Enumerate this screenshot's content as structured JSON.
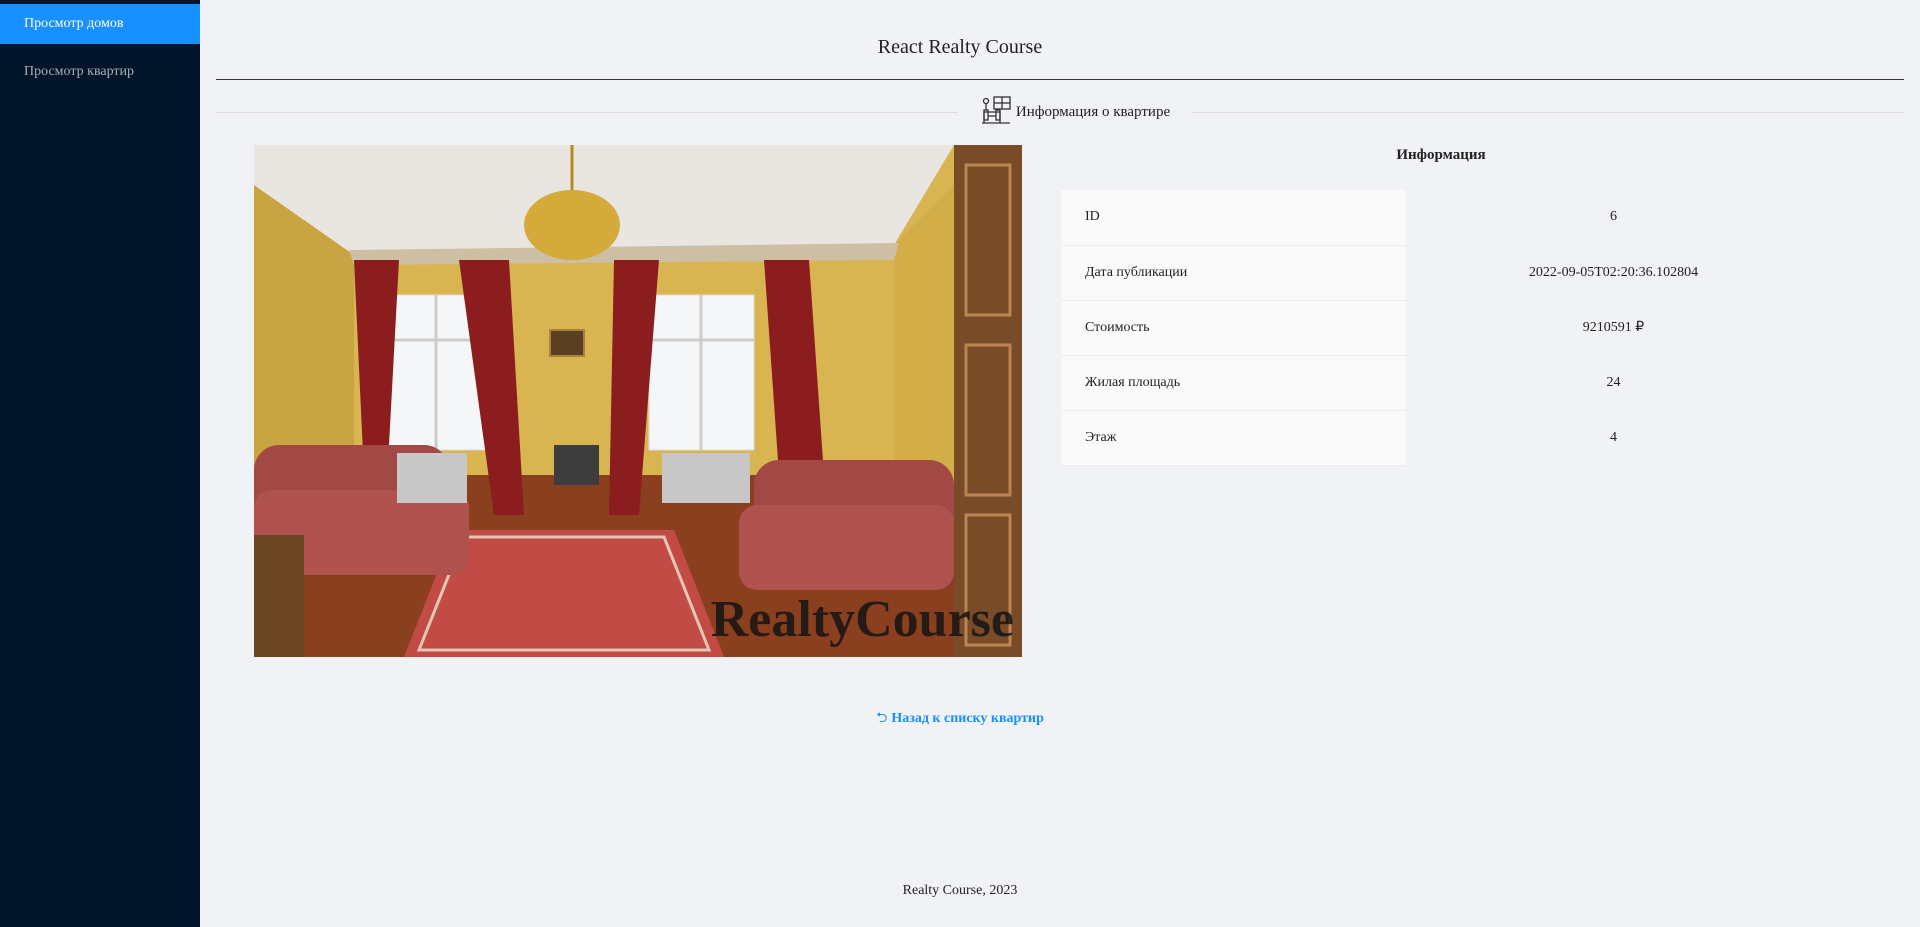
{
  "sidebar": {
    "items": [
      {
        "label": "Просмотр домов",
        "active": true
      },
      {
        "label": "Просмотр квартир",
        "active": false
      }
    ]
  },
  "header": {
    "title": "React Realty Course"
  },
  "section": {
    "title": "Информация о квартире",
    "icon": "apartment-icon"
  },
  "photo": {
    "watermark": "RealtyCourse"
  },
  "info": {
    "title": "Информация",
    "rows": [
      {
        "key": "ID",
        "value": "6"
      },
      {
        "key": "Дата публикации",
        "value": "2022-09-05T02:20:36.102804"
      },
      {
        "key": "Стоимость",
        "value": "9210591 ₽"
      },
      {
        "key": "Жилая площадь",
        "value": "24"
      },
      {
        "key": "Этаж",
        "value": "4"
      }
    ]
  },
  "back_link": {
    "icon": "⮌",
    "label": "Назад к списку квартир"
  },
  "footer": {
    "text": "Realty Course, 2023"
  },
  "colors": {
    "sidebar": "#001529",
    "accent": "#1890ff",
    "page": "#f0f2f5"
  }
}
